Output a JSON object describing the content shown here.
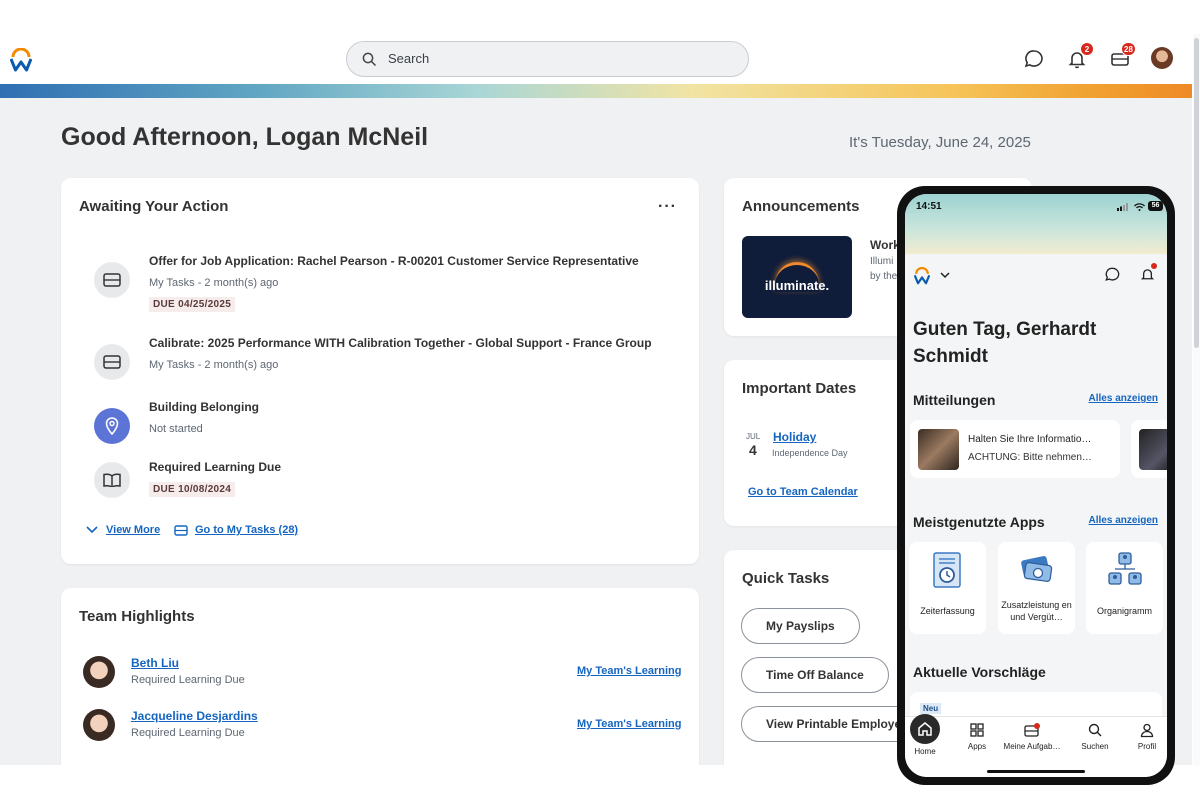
{
  "header": {
    "search_placeholder": "Search",
    "notifications_count": "2",
    "inbox_count": "28",
    "icons": [
      "workday-logo-icon",
      "search-icon",
      "chat-icon",
      "bell-icon",
      "inbox-icon",
      "avatar"
    ]
  },
  "greeting": "Good Afternoon, Logan McNeil",
  "date": "It's Tuesday, June 24, 2025",
  "awaiting": {
    "title": "Awaiting Your Action",
    "more": "···",
    "tasks": [
      {
        "title": "Offer for Job Application: Rachel Pearson - R-00201 Customer Service Representative",
        "subtitle": "My Tasks - 2 month(s) ago",
        "due": "DUE 04/25/2025",
        "icon": "inbox-icon"
      },
      {
        "title": "Calibrate: 2025 Performance WITH Calibration Together - Global Support - France Group",
        "subtitle": "My Tasks - 2 month(s) ago",
        "due": "",
        "icon": "inbox-icon"
      },
      {
        "title": "Building Belonging",
        "subtitle": "Not started",
        "due": "",
        "icon": "location-pin-icon"
      },
      {
        "title": "Required Learning Due",
        "subtitle": "",
        "due": "DUE 10/08/2024",
        "icon": "book-icon"
      }
    ],
    "view_more": "View More",
    "go_to_tasks": "Go to My Tasks (28)"
  },
  "team": {
    "title": "Team Highlights",
    "people": [
      {
        "name": "Beth Liu",
        "subtitle": "Required Learning Due",
        "link": "My Team's Learning"
      },
      {
        "name": "Jacqueline Desjardins",
        "subtitle": "Required Learning Due",
        "link": "My Team's Learning"
      }
    ]
  },
  "announcements": {
    "title": "Announcements",
    "image_text": "illuminate.",
    "heading": "Work",
    "line1": "Illumi",
    "line2": "by the"
  },
  "important_dates": {
    "title": "Important Dates",
    "month": "JUL",
    "day": "4",
    "event": "Holiday",
    "event_sub": "Independence Day",
    "calendar_link": "Go to Team Calendar"
  },
  "quick_tasks": {
    "title": "Quick Tasks",
    "buttons": [
      "My Payslips",
      "Time Off Balance",
      "View Printable Employee"
    ]
  },
  "mobile": {
    "time": "14:51",
    "battery": "56",
    "greeting": "Guten Tag, Gerhardt Schmidt",
    "notices_title": "Mitteilungen",
    "show_all": "Alles anzeigen",
    "notice_line1": "Halten Sie Ihre Informatio…",
    "notice_line2": "ACHTUNG: Bitte nehmen…",
    "apps_title": "Meistgenutzte Apps",
    "apps": [
      {
        "label": "Zeiterfassung",
        "icon": "time-tracking-icon"
      },
      {
        "label": "Zusatzleistung en und Vergüt…",
        "icon": "benefits-icon"
      },
      {
        "label": "Organigramm",
        "icon": "org-chart-icon"
      }
    ],
    "suggestions_title": "Aktuelle Vorschläge",
    "new_badge": "Neu",
    "tabs": [
      {
        "label": "Home",
        "icon": "home-icon"
      },
      {
        "label": "Apps",
        "icon": "apps-grid-icon"
      },
      {
        "label": "Meine Aufgab…",
        "icon": "tasks-inbox-icon"
      },
      {
        "label": "Suchen",
        "icon": "search-icon"
      },
      {
        "label": "Profil",
        "icon": "profile-icon"
      }
    ]
  },
  "colors": {
    "accent": "#1565c0",
    "badge": "#d6281c",
    "page_bg": "#f0f1f3"
  }
}
